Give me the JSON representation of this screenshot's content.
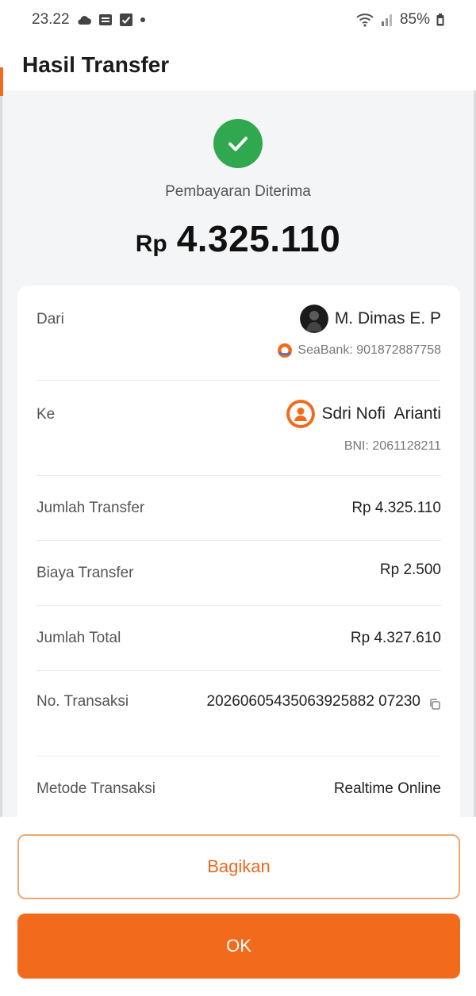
{
  "status_bar": {
    "time": "23.22",
    "battery": "85%",
    "icons": [
      "cloud-icon",
      "image-icon",
      "check-box-icon",
      "dot-icon",
      "wifi-icon",
      "signal-icon",
      "battery-icon"
    ]
  },
  "header": {
    "title": "Hasil Transfer"
  },
  "result": {
    "status": "Pembayaran Diterima",
    "currency": "Rp",
    "amount": "4.325.110",
    "icon": "check-circle-icon"
  },
  "details": {
    "from": {
      "label": "Dari",
      "name": "M. Dimas E. P",
      "account": "SeaBank: 901872887758"
    },
    "to": {
      "label": "Ke",
      "name": "Sdri Nofi  Arianti",
      "account": "BNI: 2061128211"
    },
    "transfer_amount": {
      "label": "Jumlah Transfer",
      "value": "Rp 4.325.110"
    },
    "transfer_fee": {
      "label": "Biaya Transfer",
      "value": "Rp 2.500"
    },
    "total": {
      "label": "Jumlah Total",
      "value": "Rp 4.327.610"
    },
    "transaction_no": {
      "label": "No. Transaksi",
      "value": "20260605435063925882 07230"
    },
    "method": {
      "label": "Metode Transaksi",
      "value": "Realtime Online"
    }
  },
  "actions": {
    "share_label": "Bagikan",
    "ok_label": "OK"
  },
  "colors": {
    "accent": "#f26b1d",
    "success": "#2fa84f",
    "background": "#f4f5f7"
  }
}
